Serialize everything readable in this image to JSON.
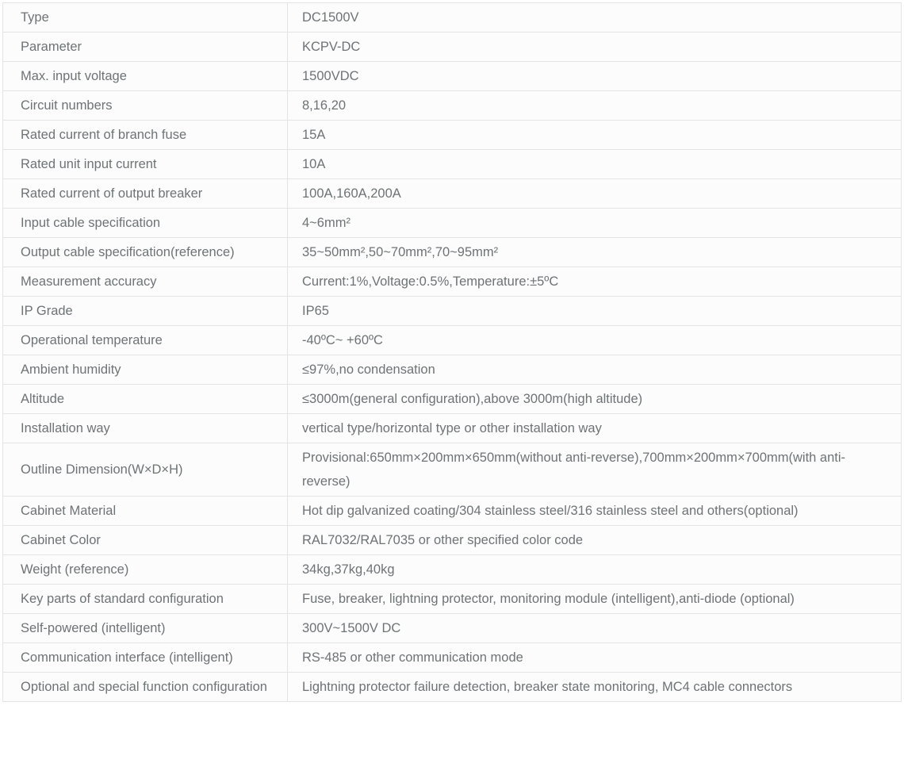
{
  "table": {
    "columns": [
      "Type",
      "DC1500V"
    ],
    "rows": [
      {
        "label": "Type",
        "value": "DC1500V"
      },
      {
        "label": "Parameter",
        "value": "KCPV-DC"
      },
      {
        "label": "Max. input voltage",
        "value": "1500VDC"
      },
      {
        "label": "Circuit numbers",
        "value": "8,16,20"
      },
      {
        "label": "Rated current of branch fuse",
        "value": "15A"
      },
      {
        "label": "Rated unit input current",
        "value": "10A"
      },
      {
        "label": "Rated current of output breaker",
        "value": "100A,160A,200A"
      },
      {
        "label": "Input cable specification",
        "value": "4~6mm²"
      },
      {
        "label": "Output cable specification(reference)",
        "value": "35~50mm²,50~70mm²,70~95mm²"
      },
      {
        "label": "Measurement accuracy",
        "value": "Current:1%,Voltage:0.5%,Temperature:±5ºC"
      },
      {
        "label": "IP Grade",
        "value": "IP65"
      },
      {
        "label": "Operational temperature",
        "value": "-40ºC~ +60ºC"
      },
      {
        "label": "Ambient humidity",
        "value": "≤97%,no condensation"
      },
      {
        "label": "Altitude",
        "value": "≤3000m(general configuration),above 3000m(high altitude)"
      },
      {
        "label": "Installation way",
        "value": "vertical type/horizontal type or other installation way"
      },
      {
        "label": "Outline Dimension(W×D×H)",
        "value": "Provisional:650mm×200mm×650mm(without anti-reverse),700mm×200mm×700mm(with anti-reverse)"
      },
      {
        "label": "Cabinet Material",
        "value": "Hot dip galvanized coating/304 stainless steel/316 stainless steel and others(optional)"
      },
      {
        "label": "Cabinet Color",
        "value": "RAL7032/RAL7035 or other specified color code"
      },
      {
        "label": "Weight (reference)",
        "value": "34kg,37kg,40kg"
      },
      {
        "label": "Key parts of standard configuration",
        "value": "Fuse, breaker, lightning protector, monitoring module (intelligent),anti-diode (optional)"
      },
      {
        "label": "Self-powered (intelligent)",
        "value": "300V~1500V DC"
      },
      {
        "label": "Communication interface (intelligent)",
        "value": "RS-485 or other communication mode"
      },
      {
        "label": "Optional and special function configuration",
        "value": "Lightning protector failure detection, breaker state monitoring, MC4 cable connectors"
      }
    ]
  },
  "style": {
    "text_color": "#6e7375",
    "border_color": "#e2e4e6",
    "row_background": "#fcfcfc",
    "page_background": "#ffffff"
  }
}
